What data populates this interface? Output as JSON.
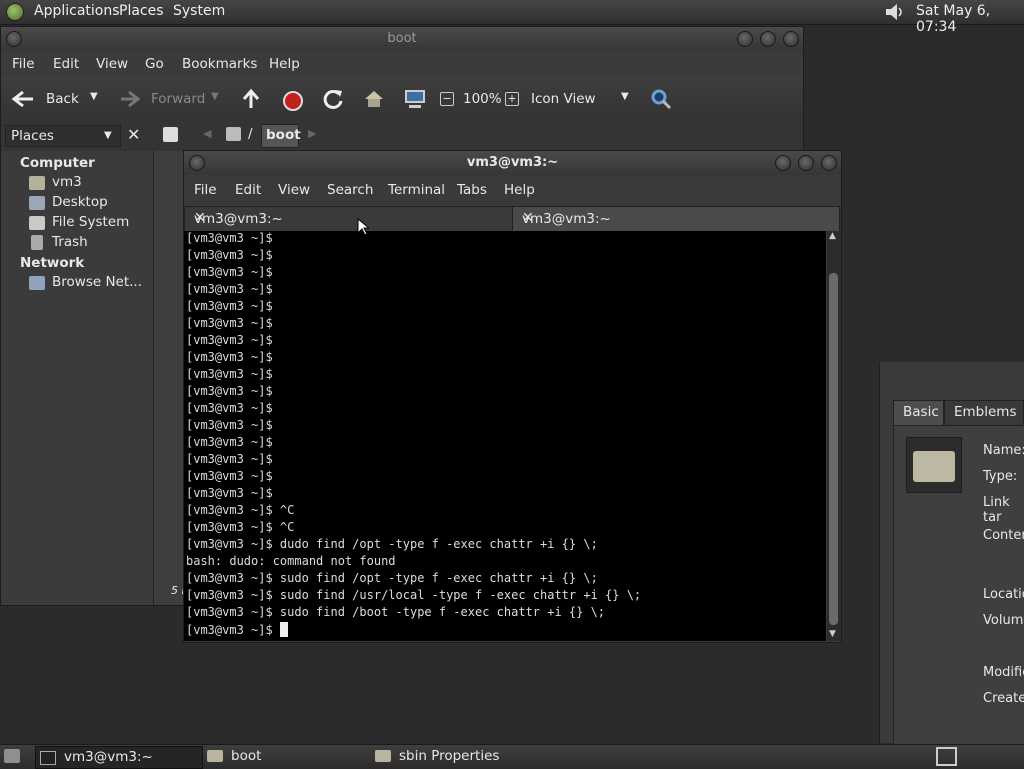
{
  "top_panel": {
    "menus": [
      "Applications",
      "Places",
      "System"
    ],
    "clock": "Sat May  6, 07:34"
  },
  "nautilus": {
    "title": "boot",
    "menu": [
      "File",
      "Edit",
      "View",
      "Go",
      "Bookmarks",
      "Help"
    ],
    "toolbar": {
      "back": "Back",
      "forward": "Forward",
      "zoom": "100%",
      "view_mode": "Icon View"
    },
    "sidebar": {
      "selector": "Places",
      "computer_header": "Computer",
      "items": [
        "vm3",
        "Desktop",
        "File System",
        "Trash"
      ],
      "network_header": "Network",
      "network_items": [
        "Browse Net..."
      ]
    },
    "path": {
      "root": "/",
      "current": "boot"
    },
    "status_fragment": "5 i"
  },
  "terminal": {
    "title": "vm3@vm3:~",
    "menu": [
      "File",
      "Edit",
      "View",
      "Search",
      "Terminal",
      "Tabs",
      "Help"
    ],
    "tabs": [
      "vm3@vm3:~",
      "vm3@vm3:~"
    ],
    "lines": [
      "[vm3@vm3 ~]$",
      "[vm3@vm3 ~]$",
      "[vm3@vm3 ~]$",
      "[vm3@vm3 ~]$",
      "[vm3@vm3 ~]$",
      "[vm3@vm3 ~]$",
      "[vm3@vm3 ~]$",
      "[vm3@vm3 ~]$",
      "[vm3@vm3 ~]$",
      "[vm3@vm3 ~]$",
      "[vm3@vm3 ~]$",
      "[vm3@vm3 ~]$",
      "[vm3@vm3 ~]$",
      "[vm3@vm3 ~]$",
      "[vm3@vm3 ~]$",
      "[vm3@vm3 ~]$",
      "[vm3@vm3 ~]$ ^C",
      "[vm3@vm3 ~]$ ^C",
      "[vm3@vm3 ~]$ dudo find /opt -type f -exec chattr +i {} \\;",
      "bash: dudo: command not found",
      "[vm3@vm3 ~]$ sudo find /opt -type f -exec chattr +i {} \\;",
      "[vm3@vm3 ~]$ sudo find /usr/local -type f -exec chattr +i {} \\;",
      "[vm3@vm3 ~]$ sudo find /boot -type f -exec chattr +i {} \\;"
    ],
    "prompt": "[vm3@vm3 ~]$ "
  },
  "properties": {
    "tabs": [
      "Basic",
      "Emblems"
    ],
    "labels": [
      "Name:",
      "Type:",
      "Link tar",
      "Conten",
      "Location",
      "Volume",
      "Modifie",
      "Created"
    ]
  },
  "taskbar": {
    "tasks": [
      "vm3@vm3:~",
      "boot",
      "sbin Properties"
    ]
  }
}
